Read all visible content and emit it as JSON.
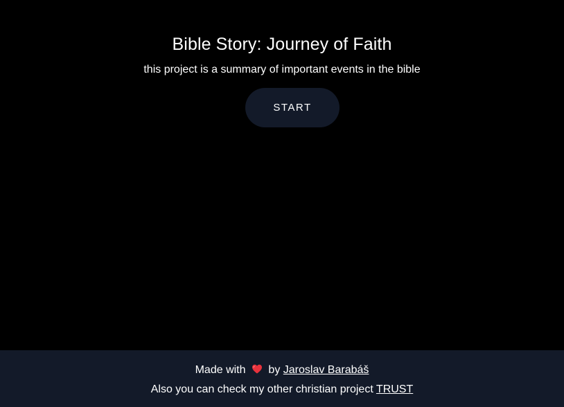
{
  "hero": {
    "title": "Bible Story: Journey of Faith",
    "subtitle": "this project is a summary of important events in the bible",
    "start_label": "START"
  },
  "footer": {
    "made_with": "Made with",
    "heart_icon": "heart-icon",
    "by": "by",
    "author": "Jaroslav Barabáš",
    "also_text": "Also you can check my other christian project",
    "project_link": "TRUST"
  },
  "colors": {
    "background": "#000000",
    "footer_bg": "#131a29",
    "button_bg": "#131a29",
    "text": "#ffffff",
    "heart": "#e8323c"
  }
}
